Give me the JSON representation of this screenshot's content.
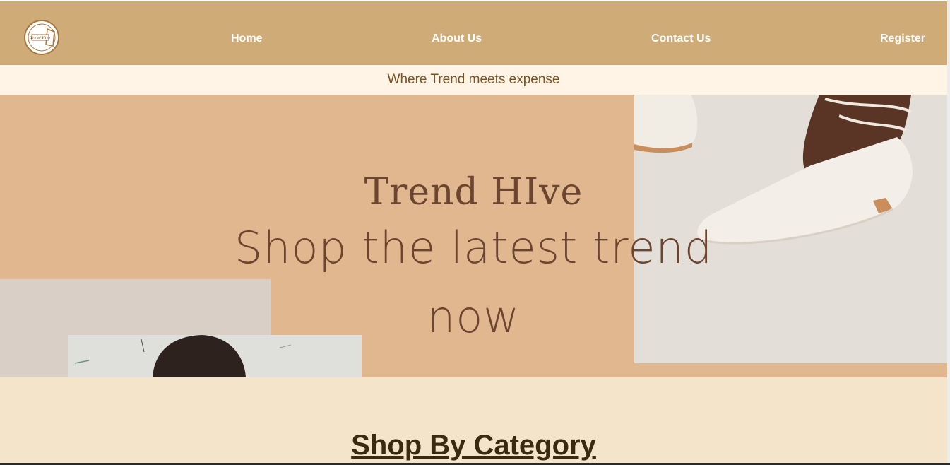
{
  "nav": {
    "logo_text": "Trend Hive",
    "links": [
      "Home",
      "About Us",
      "Contact Us",
      "Register"
    ]
  },
  "tagline": "Where Trend meets expense",
  "hero": {
    "title": "Trend HIve",
    "subtitle_line1": "Shop the latest trend",
    "subtitle_line2": "now"
  },
  "category_heading": "Shop By Category",
  "colors": {
    "nav_bg": "#cfab77",
    "tagline_bg": "#fff4e5",
    "hero_bg": "#e1b78f",
    "category_bg": "#f4e4c9",
    "hero_text": "#6b4530"
  }
}
